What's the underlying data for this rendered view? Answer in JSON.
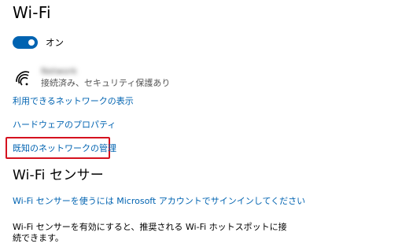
{
  "page": {
    "title": "Wi-Fi"
  },
  "toggle": {
    "label": "オン",
    "state": "on",
    "color": "#0063b1"
  },
  "network": {
    "icon": "wifi-signal-icon",
    "name": "Network",
    "status": "接続済み、セキュリティ保護あり"
  },
  "links": {
    "available_networks": "利用できるネットワークの表示",
    "hardware_properties": "ハードウェアのプロパティ",
    "manage_known_networks": "既知のネットワークの管理"
  },
  "sensor": {
    "heading": "Wi-Fi センサー",
    "signin_link": "Wi-Fi センサーを使うには Microsoft アカウントでサインインしてください",
    "description": "Wi-Fi センサーを有効にすると、推奨される Wi-Fi ホットスポットに接続できます。"
  },
  "colors": {
    "link": "#0063b1",
    "highlight": "#d5121f"
  }
}
